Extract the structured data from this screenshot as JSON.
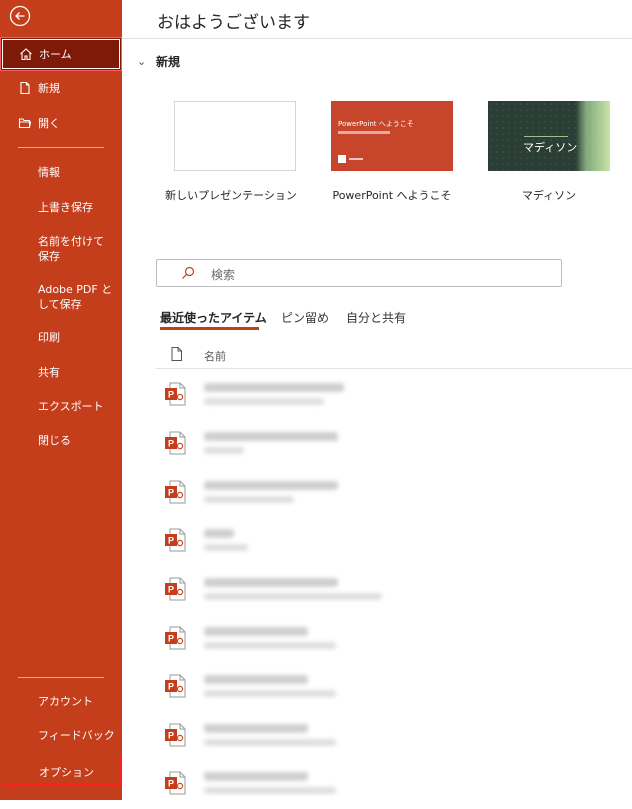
{
  "greeting": "おはようございます",
  "sidebar": {
    "home": "ホーム",
    "new": "新規",
    "open": "開く",
    "info": "情報",
    "overwrite_save": "上書き保存",
    "save_as": "名前を付けて保存",
    "save_as_pdf": "Adobe PDF として保存",
    "print": "印刷",
    "share": "共有",
    "export": "エクスポート",
    "close": "閉じる",
    "account": "アカウント",
    "feedback": "フィードバック",
    "options": "オプション"
  },
  "new_section": {
    "title": "新規",
    "templates": [
      {
        "caption": "新しいプレゼンテーション"
      },
      {
        "caption": "PowerPoint へようこそ",
        "thumb_title": "PowerPoint へようこそ"
      },
      {
        "caption": "マディソン",
        "thumb_title": "マディソン"
      }
    ]
  },
  "search": {
    "placeholder": "検索"
  },
  "tabs": {
    "recent": "最近使ったアイテム",
    "pinned": "ピン留め",
    "shared": "自分と共有"
  },
  "file_list": {
    "name_header": "名前"
  },
  "colors": {
    "accent": "#c43e1c",
    "active": "#7f1a09"
  }
}
